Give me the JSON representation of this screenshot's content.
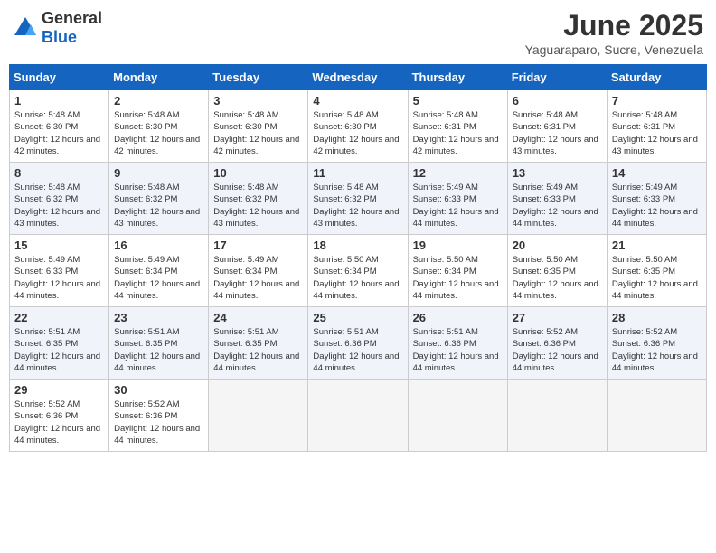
{
  "header": {
    "logo_general": "General",
    "logo_blue": "Blue",
    "month": "June 2025",
    "location": "Yaguaraparo, Sucre, Venezuela"
  },
  "weekdays": [
    "Sunday",
    "Monday",
    "Tuesday",
    "Wednesday",
    "Thursday",
    "Friday",
    "Saturday"
  ],
  "weeks": [
    [
      {
        "day": "1",
        "sunrise": "5:48 AM",
        "sunset": "6:30 PM",
        "daylight": "12 hours and 42 minutes."
      },
      {
        "day": "2",
        "sunrise": "5:48 AM",
        "sunset": "6:30 PM",
        "daylight": "12 hours and 42 minutes."
      },
      {
        "day": "3",
        "sunrise": "5:48 AM",
        "sunset": "6:30 PM",
        "daylight": "12 hours and 42 minutes."
      },
      {
        "day": "4",
        "sunrise": "5:48 AM",
        "sunset": "6:30 PM",
        "daylight": "12 hours and 42 minutes."
      },
      {
        "day": "5",
        "sunrise": "5:48 AM",
        "sunset": "6:31 PM",
        "daylight": "12 hours and 42 minutes."
      },
      {
        "day": "6",
        "sunrise": "5:48 AM",
        "sunset": "6:31 PM",
        "daylight": "12 hours and 43 minutes."
      },
      {
        "day": "7",
        "sunrise": "5:48 AM",
        "sunset": "6:31 PM",
        "daylight": "12 hours and 43 minutes."
      }
    ],
    [
      {
        "day": "8",
        "sunrise": "5:48 AM",
        "sunset": "6:32 PM",
        "daylight": "12 hours and 43 minutes."
      },
      {
        "day": "9",
        "sunrise": "5:48 AM",
        "sunset": "6:32 PM",
        "daylight": "12 hours and 43 minutes."
      },
      {
        "day": "10",
        "sunrise": "5:48 AM",
        "sunset": "6:32 PM",
        "daylight": "12 hours and 43 minutes."
      },
      {
        "day": "11",
        "sunrise": "5:48 AM",
        "sunset": "6:32 PM",
        "daylight": "12 hours and 43 minutes."
      },
      {
        "day": "12",
        "sunrise": "5:49 AM",
        "sunset": "6:33 PM",
        "daylight": "12 hours and 44 minutes."
      },
      {
        "day": "13",
        "sunrise": "5:49 AM",
        "sunset": "6:33 PM",
        "daylight": "12 hours and 44 minutes."
      },
      {
        "day": "14",
        "sunrise": "5:49 AM",
        "sunset": "6:33 PM",
        "daylight": "12 hours and 44 minutes."
      }
    ],
    [
      {
        "day": "15",
        "sunrise": "5:49 AM",
        "sunset": "6:33 PM",
        "daylight": "12 hours and 44 minutes."
      },
      {
        "day": "16",
        "sunrise": "5:49 AM",
        "sunset": "6:34 PM",
        "daylight": "12 hours and 44 minutes."
      },
      {
        "day": "17",
        "sunrise": "5:49 AM",
        "sunset": "6:34 PM",
        "daylight": "12 hours and 44 minutes."
      },
      {
        "day": "18",
        "sunrise": "5:50 AM",
        "sunset": "6:34 PM",
        "daylight": "12 hours and 44 minutes."
      },
      {
        "day": "19",
        "sunrise": "5:50 AM",
        "sunset": "6:34 PM",
        "daylight": "12 hours and 44 minutes."
      },
      {
        "day": "20",
        "sunrise": "5:50 AM",
        "sunset": "6:35 PM",
        "daylight": "12 hours and 44 minutes."
      },
      {
        "day": "21",
        "sunrise": "5:50 AM",
        "sunset": "6:35 PM",
        "daylight": "12 hours and 44 minutes."
      }
    ],
    [
      {
        "day": "22",
        "sunrise": "5:51 AM",
        "sunset": "6:35 PM",
        "daylight": "12 hours and 44 minutes."
      },
      {
        "day": "23",
        "sunrise": "5:51 AM",
        "sunset": "6:35 PM",
        "daylight": "12 hours and 44 minutes."
      },
      {
        "day": "24",
        "sunrise": "5:51 AM",
        "sunset": "6:35 PM",
        "daylight": "12 hours and 44 minutes."
      },
      {
        "day": "25",
        "sunrise": "5:51 AM",
        "sunset": "6:36 PM",
        "daylight": "12 hours and 44 minutes."
      },
      {
        "day": "26",
        "sunrise": "5:51 AM",
        "sunset": "6:36 PM",
        "daylight": "12 hours and 44 minutes."
      },
      {
        "day": "27",
        "sunrise": "5:52 AM",
        "sunset": "6:36 PM",
        "daylight": "12 hours and 44 minutes."
      },
      {
        "day": "28",
        "sunrise": "5:52 AM",
        "sunset": "6:36 PM",
        "daylight": "12 hours and 44 minutes."
      }
    ],
    [
      {
        "day": "29",
        "sunrise": "5:52 AM",
        "sunset": "6:36 PM",
        "daylight": "12 hours and 44 minutes."
      },
      {
        "day": "30",
        "sunrise": "5:52 AM",
        "sunset": "6:36 PM",
        "daylight": "12 hours and 44 minutes."
      },
      null,
      null,
      null,
      null,
      null
    ]
  ]
}
